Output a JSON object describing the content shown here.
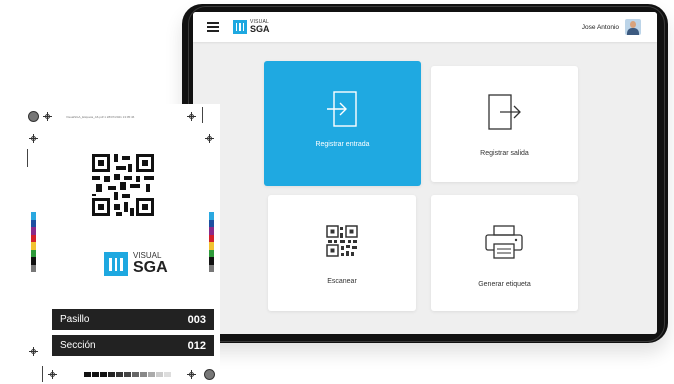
{
  "app": {
    "logo_top": "VISUAL",
    "logo_bottom": "SGA",
    "user_name": "Jose Antonio"
  },
  "cards": [
    {
      "label": "Registrar entrada",
      "icon": "login-icon",
      "active": true
    },
    {
      "label": "Registrar salida",
      "icon": "logout-icon",
      "active": false
    },
    {
      "label": "Escanear",
      "icon": "qr-code-icon",
      "active": false
    },
    {
      "label": "Generar etiqueta",
      "icon": "printer-icon",
      "active": false
    }
  ],
  "label_sheet": {
    "doc_header": "VisualSGA_Etiqueta_A6.pdf 1 28/07/2021 13:05:46",
    "logo_top": "VISUAL",
    "logo_bottom": "SGA",
    "rows": [
      {
        "key": "Pasillo",
        "value": "003"
      },
      {
        "key": "Sección",
        "value": "012"
      }
    ]
  },
  "colors": {
    "accent": "#1fa9e1",
    "screen_bg": "#efefef",
    "row_bg": "#222222",
    "strip": [
      "#2aa8e0",
      "#1c4fa0",
      "#8a2a8a",
      "#d4212a",
      "#f2c230",
      "#2e9a3a",
      "#111111",
      "#777777"
    ]
  }
}
